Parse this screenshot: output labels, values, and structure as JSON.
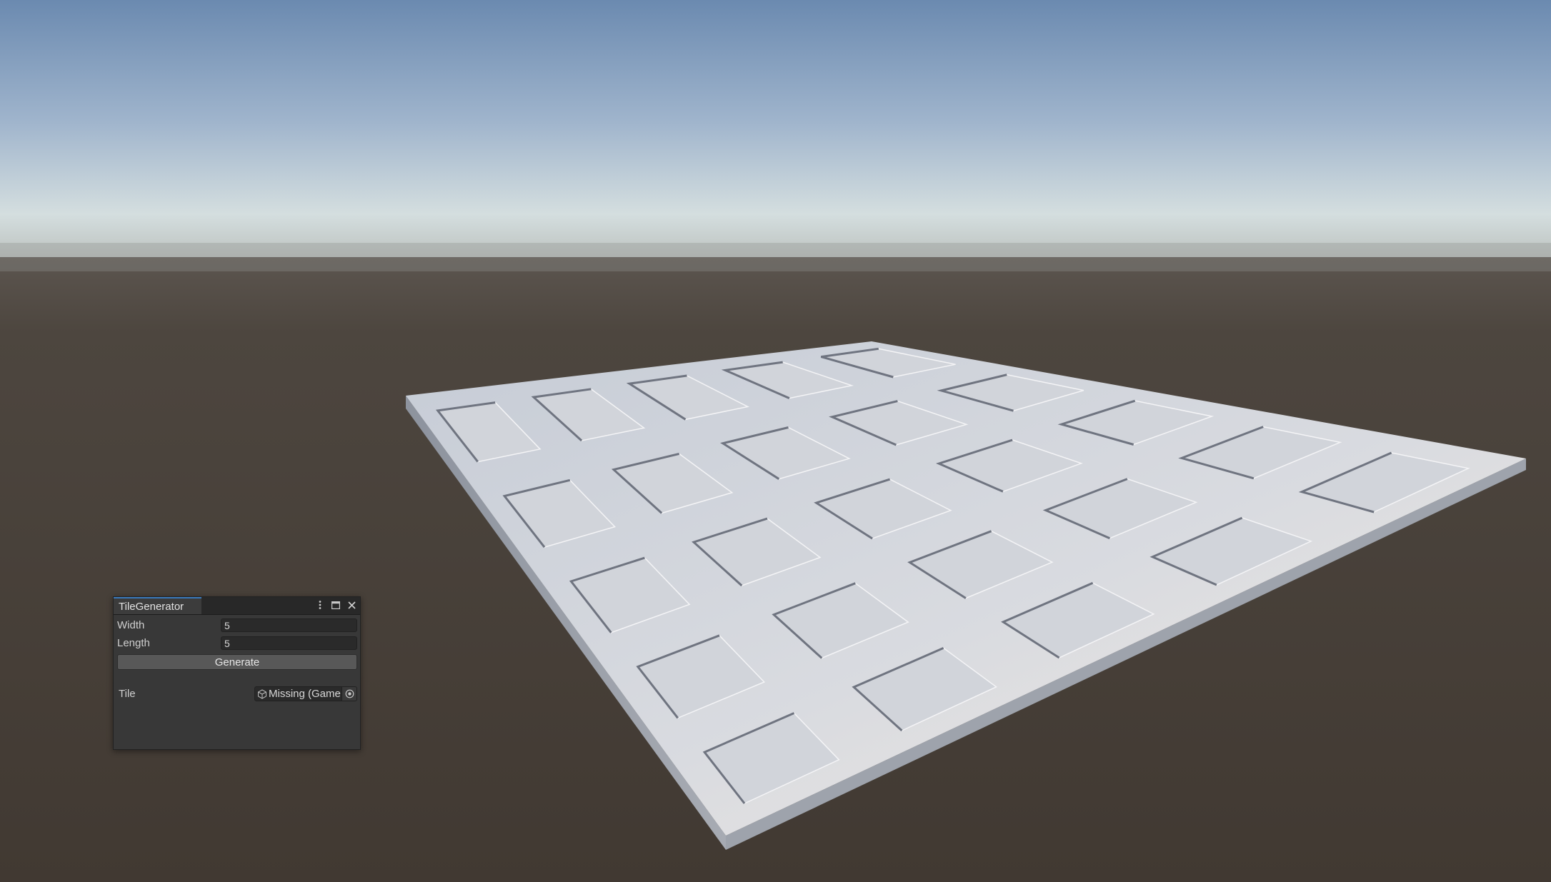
{
  "window": {
    "tab_title": "TileGenerator"
  },
  "fields": {
    "width_label": "Width",
    "width_value": "5",
    "length_label": "Length",
    "length_value": "5",
    "generate_label": "Generate",
    "tile_label": "Tile",
    "tile_value": "Missing (Game"
  },
  "icons": {
    "menu": "kebab-menu-icon",
    "maximize": "maximize-icon",
    "close": "close-icon",
    "object": "prefab-cube-icon",
    "picker": "object-picker-icon"
  },
  "colors": {
    "sky_top": "#6c8bb1",
    "horizon": "#d8e0e0",
    "ground": "#463e37",
    "tile_surface": "#dcdee2",
    "accent_tab": "#3a79bb"
  }
}
